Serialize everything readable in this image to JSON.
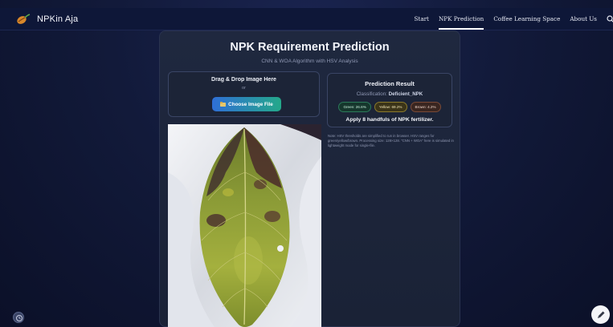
{
  "nav": {
    "brand": "NPKin Aja",
    "links": [
      {
        "label": "Start",
        "active": false
      },
      {
        "label": "NPK Prediction",
        "active": true
      },
      {
        "label": "Coffee Learning Space",
        "active": false
      },
      {
        "label": "About Us",
        "active": false
      }
    ],
    "search_icon": "search-icon"
  },
  "main": {
    "title": "NPK Requirement Prediction",
    "subtitle": "CNN & WOA Algorithm with HSV Analysis",
    "upload": {
      "drag_text": "Drag & Drop Image Here",
      "or_text": "or",
      "button_label": "Choose Image File",
      "button_icon": "folder-icon"
    },
    "result": {
      "title": "Prediction Result",
      "classification_label": "Classification:",
      "classification_value": "Deficient_NPK",
      "chips": [
        {
          "label": "Green: 26.6%",
          "kind": "green"
        },
        {
          "label": "Yellow: 69.2%",
          "kind": "yellow"
        },
        {
          "label": "Brown: 4.2%",
          "kind": "brown"
        }
      ],
      "recommendation": "Apply 8 handfuls of NPK fertilizer."
    },
    "note": "Note: HSV thresholds are simplified to run in browser. HSV ranges for green/yellow/brown. Processing size: 128×128. \"CNN + WOA\" here is simulated in lightweight mode for single-file."
  },
  "colors": {
    "accent_start": "#2f6fd6",
    "accent_end": "#24a88a",
    "background": "#121a3a"
  }
}
